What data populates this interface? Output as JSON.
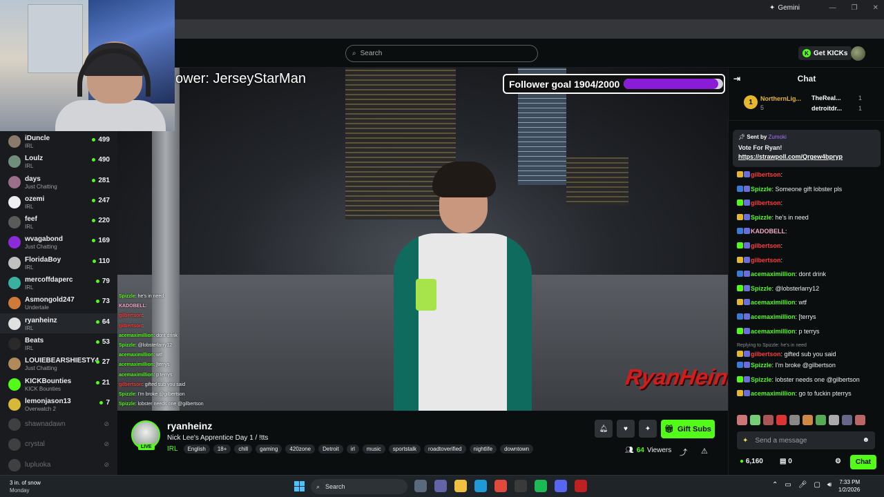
{
  "browser": {
    "gemini_label": "Gemini"
  },
  "header": {
    "search_placeholder": "Search",
    "get_kicks_label": "Get KICKs"
  },
  "video": {
    "follower_text": "ower: JerseyStarMan",
    "goal_label": "Follower goal 1904/2000",
    "goal_progress": 0.952,
    "watermark": "RyanHeinz",
    "overlay_chat": [
      {
        "user": "Spizzle",
        "text": ": he's in need",
        "color": "#53fc18"
      },
      {
        "user": "KADOBELL",
        "text": ":",
        "color": "#f5a6c9"
      },
      {
        "user": "gilbertson",
        "text": ":",
        "color": "#ff3b3b"
      },
      {
        "user": "gilbertson",
        "text": ":",
        "color": "#ff3b3b"
      },
      {
        "user": "acemaximillion",
        "text": ": dont drink",
        "color": "#53fc18"
      },
      {
        "user": "Spizzle",
        "text": ": @lobsterlarry12",
        "color": "#53fc18"
      },
      {
        "user": "acemaximillion",
        "text": ": wtf",
        "color": "#53fc18"
      },
      {
        "user": "acemaximillion",
        "text": ": [terrys",
        "color": "#53fc18"
      },
      {
        "user": "acemaximillion",
        "text": ": p terrys",
        "color": "#53fc18"
      },
      {
        "user": "gilbertson",
        "text": ": gifted sub you said",
        "color": "#ff3b3b"
      },
      {
        "user": "Spizzle",
        "text": ": I'm broke @gilbertson",
        "color": "#53fc18"
      },
      {
        "user": "Spizzle",
        "text": ": lobster needs one @gilbertson",
        "color": "#53fc18"
      }
    ]
  },
  "sidebar": {
    "items": [
      {
        "name": "iDuncle",
        "category": "IRL",
        "count": "499",
        "avatar": "#8a7a6a"
      },
      {
        "name": "Loulz",
        "category": "IRL",
        "count": "490",
        "avatar": "#6f8f7a"
      },
      {
        "name": "days",
        "category": "Just Chatting",
        "count": "281",
        "avatar": "#9a6f8a"
      },
      {
        "name": "ozemi",
        "category": "IRL",
        "count": "247",
        "avatar": "#efefef"
      },
      {
        "name": "feef",
        "category": "IRL",
        "count": "220",
        "avatar": "#5a5a5a"
      },
      {
        "name": "wvagabond",
        "category": "Just Chatting",
        "count": "169",
        "avatar": "#8a2ad8"
      },
      {
        "name": "FloridaBoy",
        "category": "IRL",
        "count": "110",
        "avatar": "#c0c0c0"
      },
      {
        "name": "mercoffdaperc",
        "category": "IRL",
        "count": "79",
        "avatar": "#3ab0a0"
      },
      {
        "name": "Asmongold247",
        "category": "Undertale",
        "count": "73",
        "avatar": "#d07a3a"
      },
      {
        "name": "ryanheinz",
        "category": "IRL",
        "count": "64",
        "avatar": "#e0e0e0"
      },
      {
        "name": "Beats",
        "category": "IRL",
        "count": "53",
        "avatar": "#2a2a2a"
      },
      {
        "name": "LOUIEBEARSHIESTY4",
        "category": "Just Chatting",
        "count": "27",
        "avatar": "#b08a5a"
      },
      {
        "name": "KICKBounties",
        "category": "KICK Bounties",
        "count": "21",
        "avatar": "#53fc18"
      },
      {
        "name": "lemonjason13",
        "category": "Overwatch 2",
        "count": "7",
        "avatar": "#d8b838"
      }
    ],
    "offline": [
      {
        "name": "shawnadawn"
      },
      {
        "name": "crystal"
      },
      {
        "name": "lupluoka"
      }
    ]
  },
  "stream": {
    "streamer": "ryanheinz",
    "live_label": "LIVE",
    "title": "Nick Lee's Apprentice Day 1 / !tts",
    "category": "IRL",
    "tags": [
      "English",
      "18+",
      "chill",
      "gaming",
      "420zone",
      "Detroit",
      "irl",
      "music",
      "sportstalk",
      "roadtoverified",
      "nightlife",
      "downtown"
    ],
    "gift_label": "Gift Subs",
    "viewers_count": "64",
    "viewers_label": "Viewers"
  },
  "chat": {
    "title": "Chat",
    "leaderboard": {
      "first_name": "NorthernLig...",
      "first_value": "5",
      "second_name": "TheReal...",
      "second_value": "1",
      "third_name": "detroitdr...",
      "third_value": "1"
    },
    "pinned": {
      "sent_by": "Sent by",
      "user": "Zumoki",
      "message": "Vote For Ryan!",
      "link": "https://strawpoll.com/Qrgew4bpryp"
    },
    "messages": [
      {
        "user": "gilbertson",
        "text": ":",
        "color": "#ff3b3b"
      },
      {
        "user": "Spizzle",
        "text": ": Someone gift lobster pls",
        "color": "#53fc18"
      },
      {
        "user": "gilbertson",
        "text": ":",
        "color": "#ff3b3b"
      },
      {
        "user": "Spizzle",
        "text": ": he's in need",
        "color": "#53fc18"
      },
      {
        "user": "KADOBELL",
        "text": ":",
        "color": "#f5a6c9"
      },
      {
        "user": "gilbertson",
        "text": ":",
        "color": "#ff3b3b"
      },
      {
        "user": "gilbertson",
        "text": ":",
        "color": "#ff3b3b"
      },
      {
        "user": "acemaximillion",
        "text": ": dont drink",
        "color": "#53fc18"
      },
      {
        "user": "Spizzle",
        "text": ": @lobsterlarry12",
        "color": "#53fc18"
      },
      {
        "user": "acemaximillion",
        "text": ": wtf",
        "color": "#53fc18"
      },
      {
        "user": "acemaximillion",
        "text": ": [terrys",
        "color": "#53fc18"
      },
      {
        "user": "acemaximillion",
        "text": ": p terrys",
        "color": "#53fc18"
      },
      {
        "user": "gilbertson",
        "text": ": gifted sub you said",
        "color": "#ff3b3b",
        "reply": "Replying to Spizzle: he's in need"
      },
      {
        "user": "Spizzle",
        "text": ": I'm broke @gilbertson",
        "color": "#53fc18"
      },
      {
        "user": "Spizzle",
        "text": ": lobster needs one @gilbertson",
        "color": "#53fc18"
      },
      {
        "user": "acemaximillion",
        "text": ": go to fuckin pterrys",
        "color": "#53fc18"
      }
    ],
    "input_placeholder": "Send a message",
    "kicks_balance": "6,160",
    "drops_count": "0",
    "chat_button": "Chat"
  },
  "taskbar": {
    "weather_line1": "3 in. of snow",
    "weather_line2": "Monday",
    "search_label": "Search",
    "time": "7:33 PM",
    "date": "1/2/2026"
  }
}
